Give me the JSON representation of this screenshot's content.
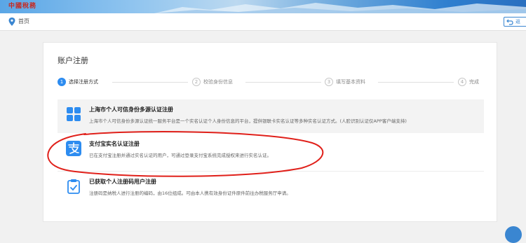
{
  "banner": {
    "logo_text": "中國稅務"
  },
  "nav": {
    "home_label": "首页",
    "back_label": "返"
  },
  "card": {
    "title": "账户注册"
  },
  "steps": [
    {
      "num": "1",
      "label": "选择注册方式",
      "active": true
    },
    {
      "num": "2",
      "label": "校验身份信息",
      "active": false
    },
    {
      "num": "3",
      "label": "填写基本资料",
      "active": false
    },
    {
      "num": "4",
      "label": "完成",
      "active": false
    }
  ],
  "options": [
    {
      "icon": "grid-icon",
      "title": "上海市个人可信身份多源认证注册",
      "desc": "上海市个人可信身份多源认证统一服务平台是一个实名认证个人身份信息的平台，提供银联卡实名认证等多种实名认证方式。(人脸识别认证仅APP客户端支持)"
    },
    {
      "icon": "alipay-icon",
      "title": "支付宝实名认证注册",
      "desc": "已在支付宝注册并通过实名认证的用户，可通过登录支付宝系统完成授权来进行实名认证。"
    },
    {
      "icon": "clipboard-check-icon",
      "title": "已获取个人注册码用户注册",
      "desc": "注册码是纳税人进行注册的编码，由16位组成。可由本人携有效身份证件原件前往办税服务厅申请。"
    }
  ],
  "colors": {
    "accent": "#2d8cf0",
    "annotation": "#e0201a"
  }
}
